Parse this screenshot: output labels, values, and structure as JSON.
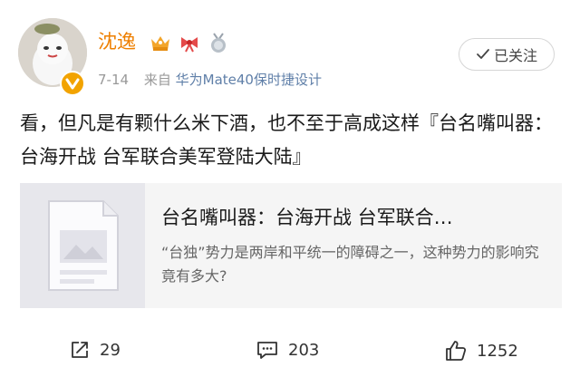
{
  "post": {
    "author": "沈逸",
    "date": "7-14",
    "source_prefix": "来自",
    "source_device": "华为Mate40保时捷设计",
    "follow_label": "已关注",
    "text": "看，但凡是有颗什么米下酒，也不至于高成这样『台名嘴叫器：台海开战 台军联合美军登陆大陆』"
  },
  "card": {
    "title": "台名嘴叫器：台海开战 台军联合…",
    "description": "“台独”势力是两岸和平统一的障碍之一，这种势力的影响究竟有多大?"
  },
  "actions": {
    "repost_count": "29",
    "comment_count": "203",
    "like_count": "1252"
  },
  "icons": [
    "verified-icon",
    "vip-crown-badge-icon",
    "ribbon-badge-icon",
    "medal-badge-icon",
    "checkmark-icon",
    "document-icon",
    "repost-icon",
    "comment-icon",
    "like-icon"
  ],
  "colors": {
    "username": "#ee7f00",
    "source": "#5f7fa8",
    "verified": "#f2a300"
  }
}
